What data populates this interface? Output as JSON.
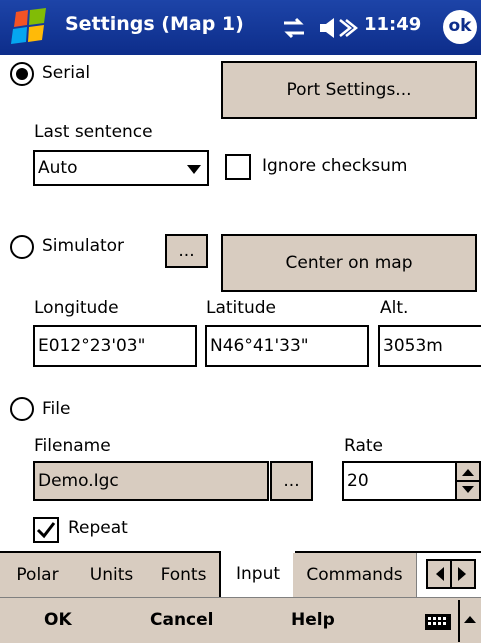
{
  "title_bar": {
    "title": "Settings (Map 1)",
    "time": "11:49",
    "ok_label": "ok"
  },
  "serial": {
    "label": "Serial",
    "selected": true,
    "port_settings_label": "Port Settings...",
    "last_sentence_label": "Last sentence",
    "last_sentence_value": "Auto",
    "ignore_checksum_label": "Ignore checksum",
    "ignore_checksum_checked": false
  },
  "simulator": {
    "label": "Simulator",
    "browse_label": "...",
    "center_on_map_label": "Center on map",
    "longitude_label": "Longitude",
    "longitude_value": "E012°23'03\"",
    "latitude_label": "Latitude",
    "latitude_value": "N46°41'33\"",
    "alt_label": "Alt.",
    "alt_value": "3053m"
  },
  "file": {
    "label": "File",
    "filename_label": "Filename",
    "filename_value": "Demo.Igc",
    "browse_label": "...",
    "rate_label": "Rate",
    "rate_value": "20",
    "repeat_label": "Repeat",
    "repeat_checked": true
  },
  "tabs": [
    {
      "label": "Polar"
    },
    {
      "label": "Units"
    },
    {
      "label": "Fonts"
    },
    {
      "label": "Input"
    },
    {
      "label": "Commands"
    }
  ],
  "active_tab": "Input",
  "menu": {
    "ok": "OK",
    "cancel": "Cancel",
    "help": "Help"
  },
  "colors": {
    "title_bar": "#0d2d8a",
    "button_face": "#d8ccc0"
  },
  "icons": {
    "start": "windows-flag-icon",
    "connectivity": "connectivity-icon",
    "volume": "speaker-icon",
    "keyboard": "keyboard-icon"
  }
}
